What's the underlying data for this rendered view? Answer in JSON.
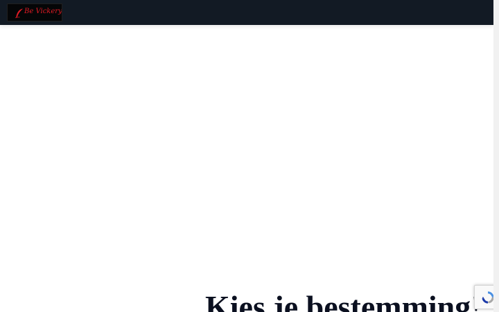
{
  "branding": {
    "logo_text": "Be Vickery"
  },
  "hero": {
    "title": "Kies je bestemming!"
  },
  "icons": {
    "logo": "quill-pen-icon",
    "recaptcha": "recaptcha-icon"
  },
  "colors": {
    "header_background": "#121a24",
    "logo_accent": "#e01b24",
    "title": "#0b1020",
    "page_background": "#ffffff"
  }
}
